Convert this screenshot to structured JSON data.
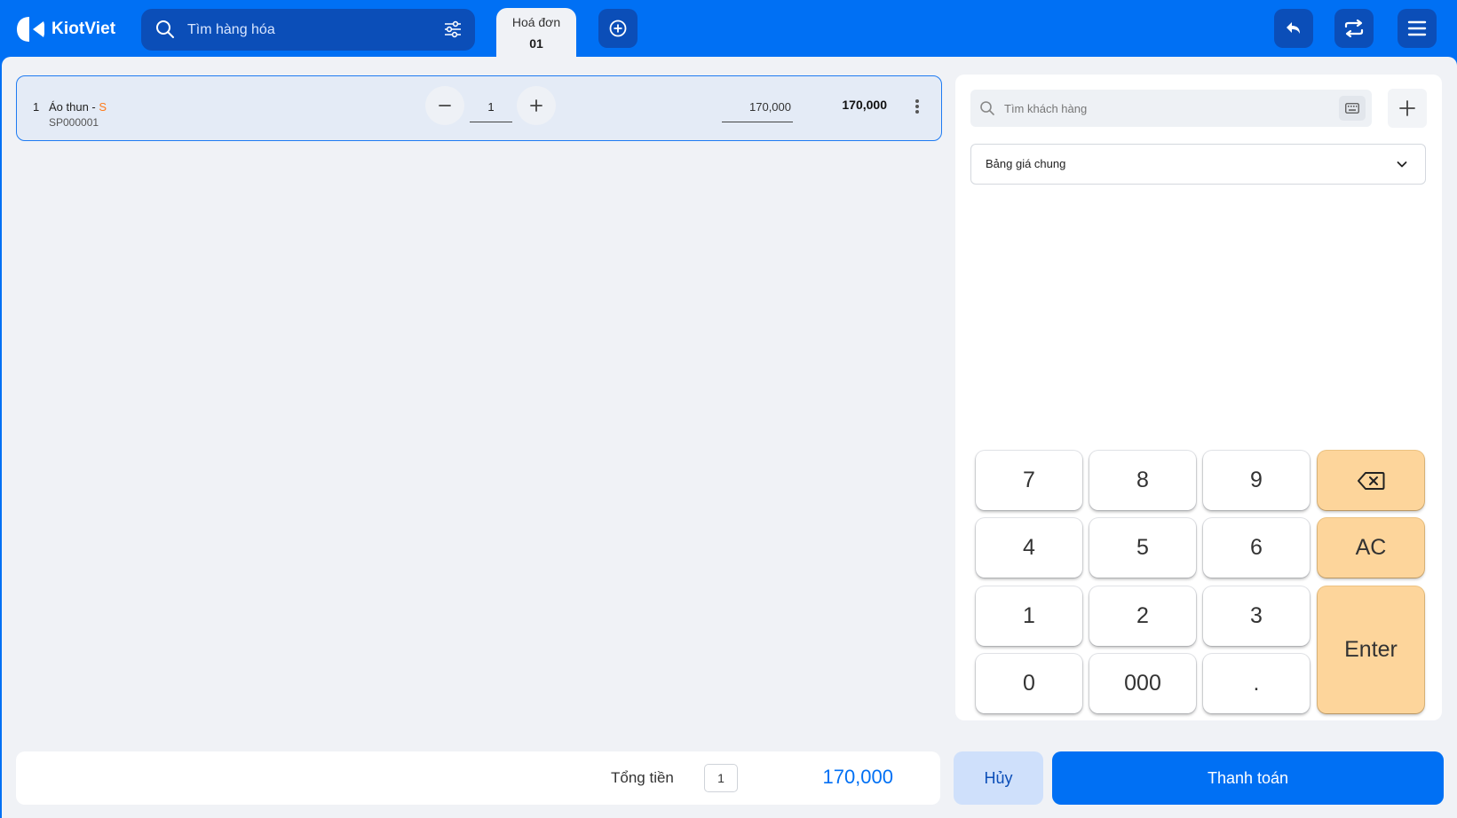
{
  "app": {
    "name": "KiotViet"
  },
  "header": {
    "search_placeholder": "Tìm hàng hóa",
    "active_tab": {
      "label": "Hoá đơn",
      "number": "01"
    },
    "icons": {
      "search": "search-icon",
      "filter": "filter-sliders-icon",
      "add_tab": "plus-circle-icon",
      "undo": "undo-arrow-icon",
      "sync": "sync-arrows-icon",
      "menu": "hamburger-menu-icon"
    }
  },
  "cart": {
    "items": [
      {
        "index": "1",
        "name": "Áo thun - ",
        "variant": "S",
        "code": "SP000001",
        "quantity": "1",
        "unit_price": "170,000",
        "line_total": "170,000"
      }
    ]
  },
  "customer_panel": {
    "search_placeholder": "Tìm khách hàng",
    "price_list": "Bảng giá chung"
  },
  "keypad": {
    "keys": [
      "7",
      "8",
      "9",
      "4",
      "5",
      "6",
      "1",
      "2",
      "3",
      "0",
      "000",
      "."
    ],
    "clear_label": "AC",
    "enter_label": "Enter",
    "backspace_icon": "backspace-icon"
  },
  "footer": {
    "total_label": "Tổng tiền",
    "total_count": "1",
    "total_amount": "170,000",
    "cancel_label": "Hủy",
    "pay_label": "Thanh toán"
  },
  "colors": {
    "primary": "#0070f4",
    "dark_blue": "#0b4eb8",
    "background": "#f0f2f6",
    "key_accent": "#fdd59b",
    "variant_accent": "#ff7a1a"
  }
}
